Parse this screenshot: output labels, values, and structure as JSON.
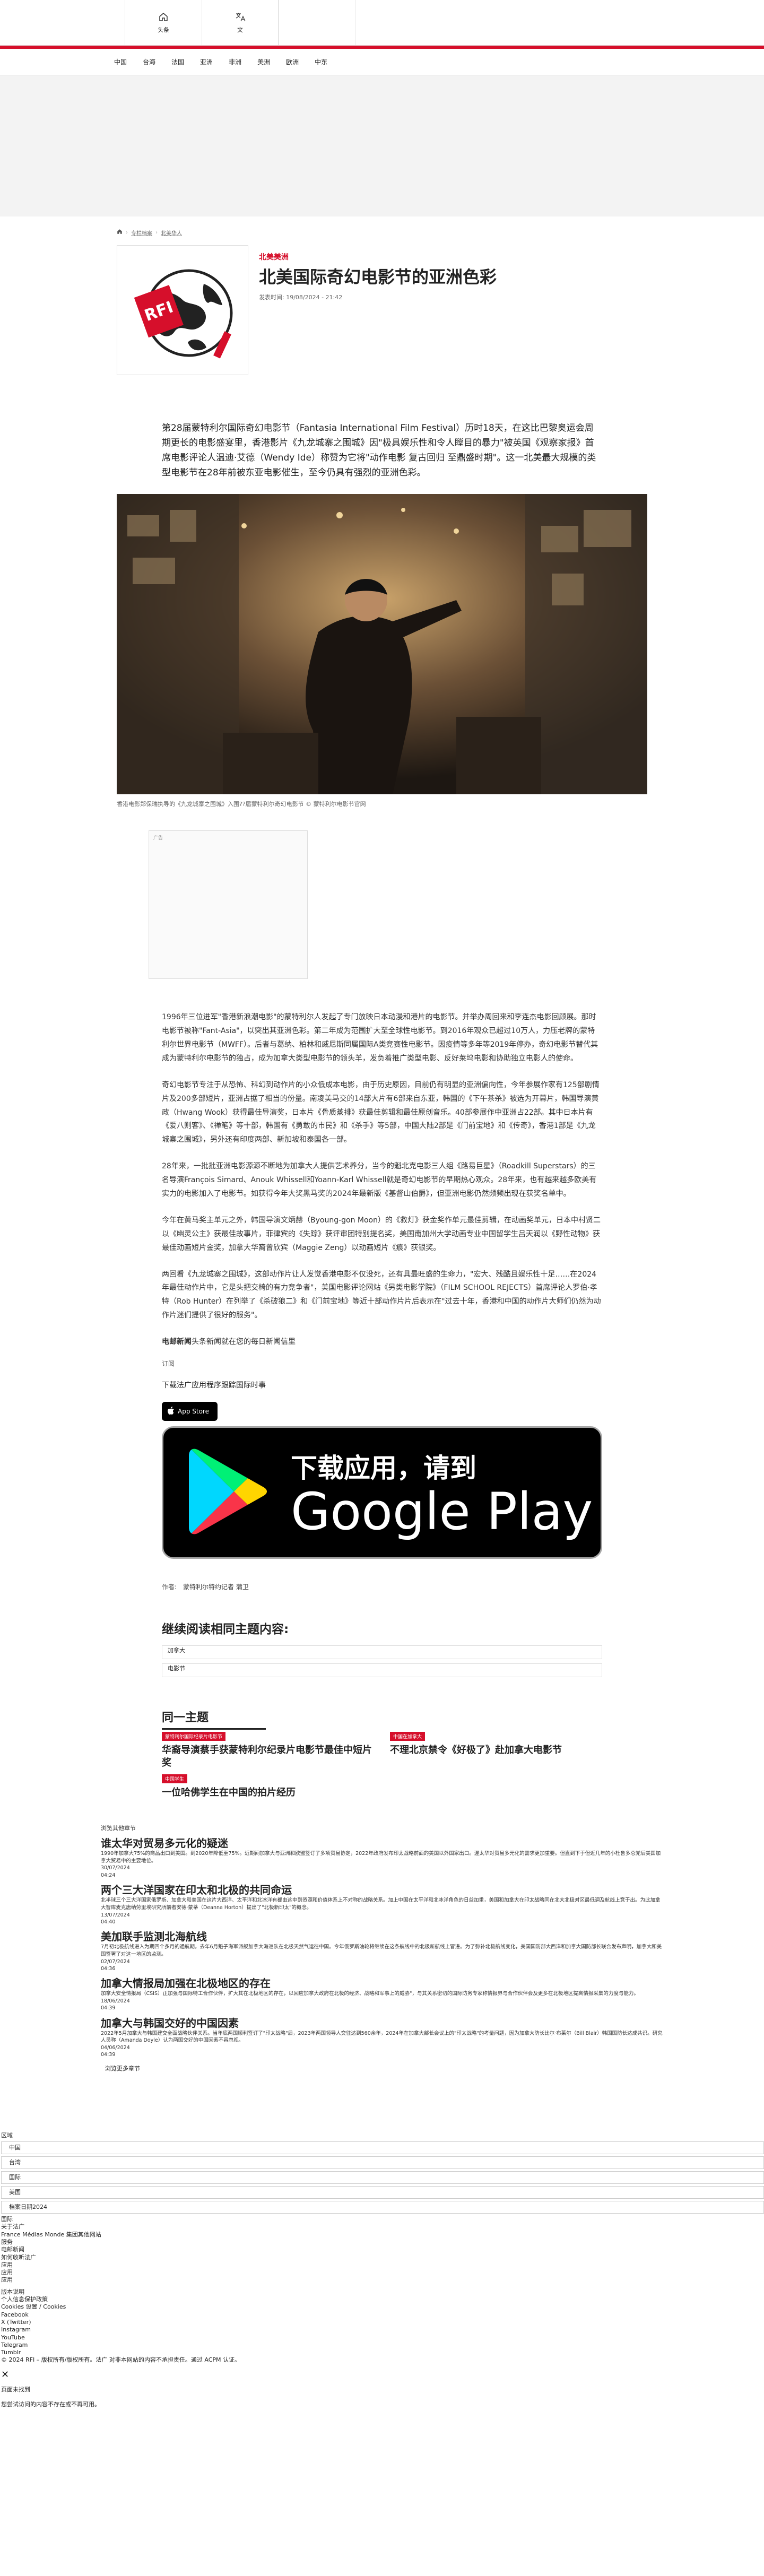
{
  "topbar": {
    "home_label": "头条",
    "lang_label": "文"
  },
  "nav": [
    "中国",
    "台海",
    "法国",
    "亚洲",
    "非洲",
    "美洲",
    "欧洲",
    "中东"
  ],
  "breadcrumb": [
    "专栏档案",
    "北美华人"
  ],
  "article": {
    "kicker": "北美美洲",
    "title": "北美国际奇幻电影节的亚洲色彩",
    "date": "发表时间: 19/08/2024 - 21:42",
    "lede": "第28届蒙特利尔国际奇幻电影节（Fantasia International Film Festival）历时18天，在这比巴黎奥运会周期更长的电影盛宴里，香港影片《九龙城寨之围城》因\"极具娱乐性和令人瞠目的暴力\"被英国《观察家报》首席电影评论人温迪·艾德（Wendy Ide）称赞为它将\"动作电影 复古回归 至鼎盛时期\"。这一北美最大规模的类型电影节在28年前被东亚电影催生，至今仍具有强烈的亚洲色彩。",
    "image_caption": "香港电影郑保瑞执导的《九龙城寨之围城》入围??届蒙特利尔奇幻电影节 © 蒙特利尔电影节官网",
    "ad_label": "广告",
    "paragraphs": [
      "1996年三位进军\"香港新浪潮电影\"的蒙特利尔人发起了专门放映日本动漫和港片的电影节。并举办周回来和李连杰电影回顾展。那时电影节被称\"Fant-Asia\"，以突出其亚洲色彩。第二年成为范围扩大至全球性电影节。到2016年观众已超过10万人，力压老牌的蒙特利尔世界电影节（MWFF）。后者与葛纳、柏林和威尼斯同属国际A类竞赛性电影节。因疫情等多年等2019年停办，奇幻电影节替代其成为蒙特利尔电影节的独占，成为加拿大类型电影节的领头羊，发负着推广类型电影、反好莱坞电影和协助独立电影人的使命。",
      "奇幻电影节专注于从恐怖、科幻到动作片的小众低成本电影，由于历史原因，目前仍有明显的亚洲偏向性，今年参展作家有125部剧情片及200多部短片，亚洲占据了相当的份量。南凌美马交的14部大片有6部来自东亚，韩国的《下午茶杀》被选为开幕片，韩国导演黄政（Hwang Wook）获得最佳导演奖，日本片《骨质蒸排》获最佳剪辑和最佳原创音乐。40部参展作中亚洲占22部。其中日本片有《爱八则客》、《禅笔》等十部，韩国有《勇敢的市民》和《杀手》等5部，中国大陆2部是《门前宝地》和《传奇》，香港1部是《九龙城寨之围城》，另外还有印度两部、新加坡和泰国各一部。",
      "28年来，一批批亚洲电影源源不断地为加拿大人提供艺术养分，当今的魁北克电影三人组《路易巨星》（Roadkill Superstars）的三名导演François Simard、Anouk Whissell和Yoann-Karl Whissell就是奇幻电影节的早期热心观众。28年来，也有越来越多欧美有实力的电影加入了电影节。如获得今年大奖黑马奖的2024年最新版《基督山伯爵》，但亚洲电影仍然频频出现在获奖名单中。",
      "今年在黄马奖主单元之外，韩国导演文炳赫（Byoung-gon Moon）的《救灯》获金奖作单元最佳剪辑，在动画奖单元，日本中村贤二以《幽灵公主》获最佳故事片，菲律宾的《失踪》获评审团特别提名奖，美国南加州大学动画专业中国留学生吕天润以《野性动物》获最佳动画短片金奖，加拿大华裔曾欣宾（Maggie Zeng）以动画短片《痕》获银奖。",
      "两回看《九龙城寨之围城》，这部动作片让人发觉香港电影不仅没死，还有具最旺盛的生命力，\"宏大、残酷且娱乐性十足……在2024年最佳动作片中，它是头把交椅的有力竞争者\"，美国电影评论网站《另类电影学院》（FILM SCHOOL REJECTS）首席评论人罗伯·孝特（Rob Hunter）在列举了《杀破狼二》和《门前宝地》等近十部动作片片后表示在\"过去十年，香港和中国的动作片大师们仍然为动作片迷们提供了很好的服务\"。"
    ],
    "newsletter_lead": "电邮新闻",
    "newsletter_text": "头条新闻就在您的每日新闻信里",
    "subscribe": "订阅",
    "download_text": "下载法广应用程序跟踪国际时事",
    "appstore_label": "App Store",
    "gplay_line1": "下载应用，请到",
    "gplay_line2": "Google Play",
    "author": "作者:　蒙特利尔特约记者 蒲卫"
  },
  "related": {
    "heading": "继续阅读相同主题内容:",
    "tags": [
      "加拿大",
      "电影节"
    ]
  },
  "same_topic": {
    "heading": "同一主题",
    "cards": [
      {
        "tag": "蒙特利尔国际纪录片电影节",
        "title": "华裔导演蔡手获蒙特利尔纪录片电影节最佳中短片奖"
      },
      {
        "tag": "中国在加拿大",
        "title": "不理北京禁令《好极了》赴加拿大电影节"
      },
      {
        "tag": "中国学生",
        "title": "一位哈佛学生在中国的拍片经历"
      }
    ]
  },
  "follow_label": "浏览其他章节",
  "more_articles": [
    {
      "title": "谁太华对贸易多元化的疑迷",
      "body": "1990年加拿大75%的商品出口到美国。到2020年降低至75%。近期间加拿大与亚洲和欧盟签订了多项贸易协定，2022年政府发布印太战略前面的美国以外国家出口。渥太华对贸易多元化的需求更加重要。但直到下于但近几年的小杜鲁多总党后美国加拿大贸易中的主要地位。",
      "date": "30/07/2024",
      "time": "04:24"
    },
    {
      "title": "两个三大洋国家在印太和北极的共同命运",
      "body": "北半球三个三大洋国家俄罗斯、加拿大和美国在这片大西洋、太平洋和北冰洋有都由这中到资源和价值体系上不对称的战略关系。加上中国在太平洋和北冰洋角色的日益加重，美国和加拿大在印太战略同在北大北极对区最低调及航线上竞于出。为此加拿大智库麦克唐纳劳里埃研究所前者安德·蒙蒂（Deanna Horton）提出了\"北极新印太\"的概念。",
      "date": "13/07/2024",
      "time": "04:40"
    },
    {
      "title": "美加联手监测北海航线",
      "body": "7月初北极航线进入为期四个多月的通航期，去年6月魁子海军派舰加拿大海巡队在北极天然气运往中国。今年俄罗斯油轮将继续在这条航线中的北极新航线上冒进。为了弥补北极航线变化，美国国防部大西洋和加拿大国防部长联合发布声明，加拿大和美国签署了对这一地区的监测。",
      "date": "02/07/2024",
      "time": "04:36"
    },
    {
      "title": "加拿大情报局加强在北极地区的存在",
      "body": "加拿大安全情报局（CSIS）正加强与国际特工合作伙伴，扩大其在北极地区的存在，以回应加拿大政府在北极的经济、战略和军事上的威胁\"，与其关系密切的国际防务专家称情报界与合作伙伴会及更多在北极地区提高情报采集的力度与能力。",
      "date": "18/06/2024",
      "time": "04:39"
    },
    {
      "title": "加拿大与韩国交好的中国因素",
      "body": "2022年5月加拿大与韩国建交全面战略伙伴关系。当年底两国顺利签订了\"印太战略\"后，2023年两国领导人交往达到560余年，2024年在加拿大部长会议上的\"印太战略\"的考量问题，因为加拿大防长比尔·布莱尔（Bill Blair）韩国国防长达成共识。研究人员称（Amanda Doyle）认为两国交好的中国因素不容忽视。",
      "date": "04/06/2024",
      "time": "04:39"
    }
  ],
  "more_label": "浏览更多章节",
  "footer": {
    "region_label": "区域",
    "rows": [
      "中国",
      "台湾",
      "国际",
      "美国"
    ],
    "archive_label": "档案日期2024",
    "groups": [
      "国际",
      "关于法广",
      "France Médias Monde 集团其他网站",
      "服务",
      "电邮新闻",
      "如何收听法广",
      "应用",
      "应用",
      "应用",
      "版本说明",
      "个人信息保护政策",
      "Cookies 设置 / Cookies",
      "Facebook",
      "X (Twitter)",
      "Instagram",
      "YouTube",
      "Telegram",
      "Tumblr"
    ],
    "copyright": "© 2024 RFI – 版权所有/版权所有。法广 对非本网站的内容不承担责任。通过 ACPM 认证。",
    "notfound_title": "页面未找到",
    "notfound_text": "您尝试访问的内容不存在或不再可用。"
  },
  "colors": {
    "accent": "#d60f2b"
  }
}
